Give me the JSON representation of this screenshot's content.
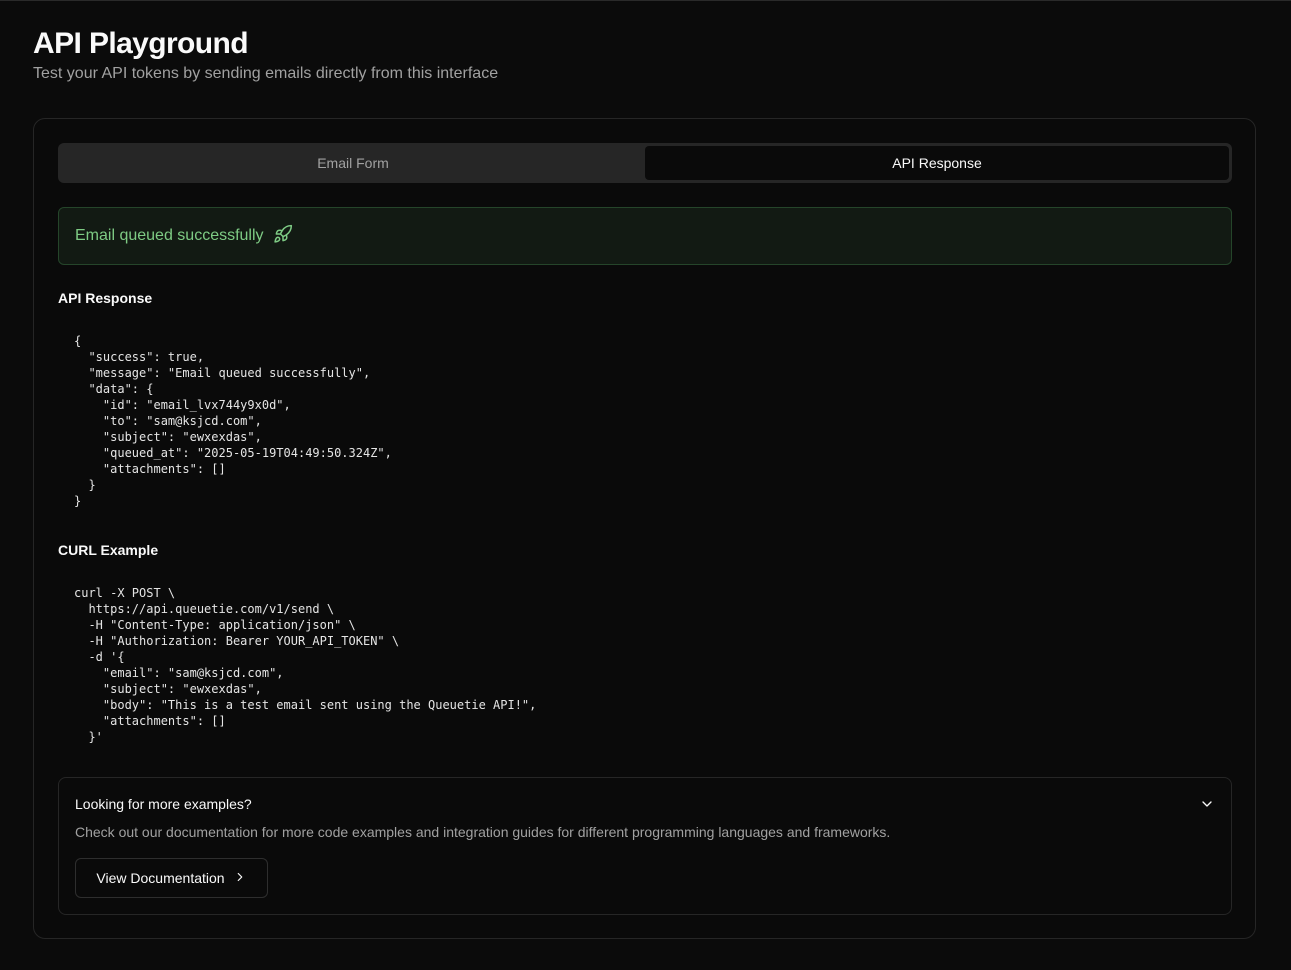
{
  "header": {
    "title": "API Playground",
    "subtitle": "Test your API tokens by sending emails directly from this interface"
  },
  "tabs": [
    {
      "label": "Email Form",
      "active": false
    },
    {
      "label": "API Response",
      "active": true
    }
  ],
  "alert": {
    "message": "Email queued successfully",
    "icon": "rocket-icon",
    "color": "#7ecb84"
  },
  "response": {
    "label": "API Response",
    "code": "{\n  \"success\": true,\n  \"message\": \"Email queued successfully\",\n  \"data\": {\n    \"id\": \"email_lvx744y9x0d\",\n    \"to\": \"sam@ksjcd.com\",\n    \"subject\": \"ewxexdas\",\n    \"queued_at\": \"2025-05-19T04:49:50.324Z\",\n    \"attachments\": []\n  }\n}"
  },
  "curl": {
    "label": "CURL Example",
    "code": "curl -X POST \\\n  https://api.queuetie.com/v1/send \\\n  -H \"Content-Type: application/json\" \\\n  -H \"Authorization: Bearer YOUR_API_TOKEN\" \\\n  -d '{\n    \"email\": \"sam@ksjcd.com\",\n    \"subject\": \"ewxexdas\",\n    \"body\": \"This is a test email sent using the Queuetie API!\",\n    \"attachments\": []\n  }'"
  },
  "examples": {
    "title": "Looking for more examples?",
    "description": "Check out our documentation for more code examples and integration guides for different programming languages and frameworks.",
    "button_label": "View Documentation"
  }
}
